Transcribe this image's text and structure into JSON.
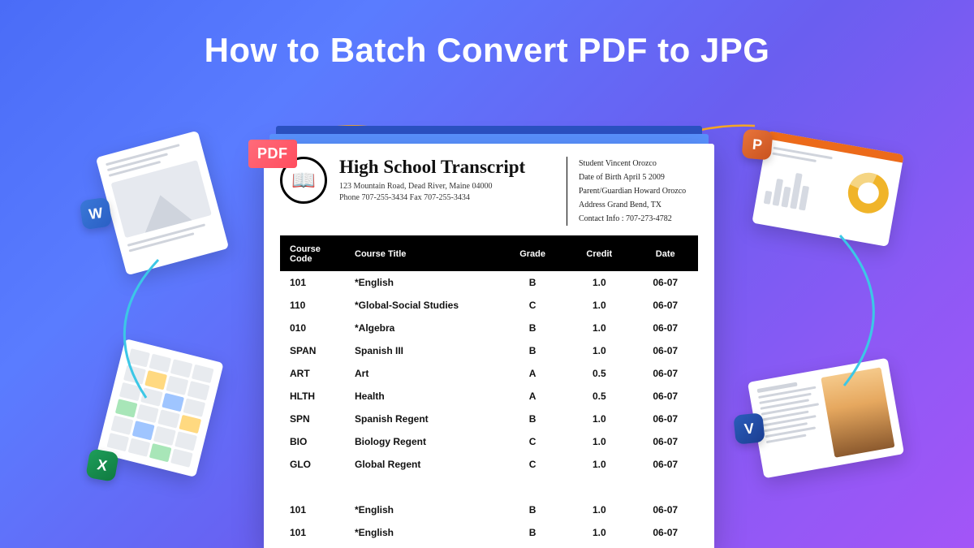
{
  "title": "How to Batch Convert PDF to JPG",
  "pdf_badge": "PDF",
  "icons": {
    "word": "W",
    "excel": "X",
    "ppt": "P",
    "visio": "V"
  },
  "transcript": {
    "logo_glyph": "📖",
    "heading": "High School Transcript",
    "address": "123 Mountain Road, Dead River, Maine 04000",
    "phone_line": "Phone  707-255-3434     Fax  707-255-3434",
    "info": {
      "student": "Student  Vincent Orozco",
      "dob": "Date of Birth  April 5  2009",
      "guardian": "Parent/Guardian  Howard Orozco",
      "address": "Address  Grand Bend, TX",
      "contact": "Contact Info : 707-273-4782"
    },
    "columns": [
      "Course Code",
      "Course Title",
      "Grade",
      "Credit",
      "Date"
    ],
    "rows": [
      {
        "code": "101",
        "title": "*English",
        "grade": "B",
        "credit": "1.0",
        "date": "06-07"
      },
      {
        "code": "110",
        "title": "*Global-Social Studies",
        "grade": "C",
        "credit": "1.0",
        "date": "06-07"
      },
      {
        "code": "010",
        "title": "*Algebra",
        "grade": "B",
        "credit": "1.0",
        "date": "06-07"
      },
      {
        "code": "SPAN",
        "title": "Spanish III",
        "grade": "B",
        "credit": "1.0",
        "date": "06-07"
      },
      {
        "code": "ART",
        "title": "Art",
        "grade": "A",
        "credit": "0.5",
        "date": "06-07"
      },
      {
        "code": "HLTH",
        "title": "Health",
        "grade": "A",
        "credit": "0.5",
        "date": "06-07"
      },
      {
        "code": "SPN",
        "title": "Spanish Regent",
        "grade": "B",
        "credit": "1.0",
        "date": "06-07"
      },
      {
        "code": "BIO",
        "title": "Biology Regent",
        "grade": "C",
        "credit": "1.0",
        "date": "06-07"
      },
      {
        "code": "GLO",
        "title": "Global Regent",
        "grade": "C",
        "credit": "1.0",
        "date": "06-07"
      }
    ],
    "rows2": [
      {
        "code": "101",
        "title": "*English",
        "grade": "B",
        "credit": "1.0",
        "date": "06-07"
      },
      {
        "code": "101",
        "title": "*English",
        "grade": "B",
        "credit": "1.0",
        "date": "06-07"
      }
    ]
  }
}
